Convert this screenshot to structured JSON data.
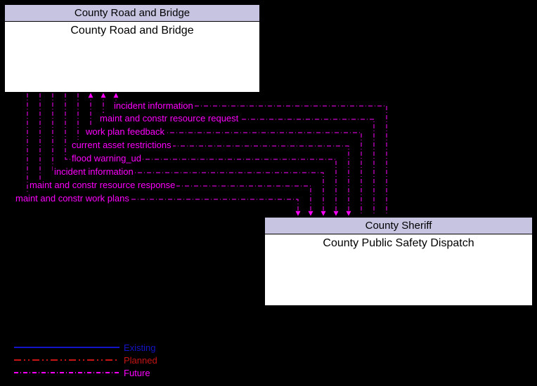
{
  "nodes": {
    "crb": {
      "header": "County Road and Bridge",
      "body": "County Road and Bridge"
    },
    "sheriff": {
      "header": "County Sheriff",
      "body": "County Public Safety Dispatch"
    }
  },
  "flows": [
    {
      "label": "incident information",
      "direction": "to_crb"
    },
    {
      "label": "maint and constr resource request",
      "direction": "to_crb"
    },
    {
      "label": "work plan feedback",
      "direction": "to_crb"
    },
    {
      "label": "current asset restrictions",
      "direction": "to_sheriff"
    },
    {
      "label": "flood warning_ud",
      "direction": "to_sheriff"
    },
    {
      "label": "incident information",
      "direction": "to_sheriff"
    },
    {
      "label": "maint and constr resource response",
      "direction": "to_sheriff"
    },
    {
      "label": "maint and constr work plans",
      "direction": "to_sheriff"
    }
  ],
  "legend": {
    "existing": "Existing",
    "planned": "Planned",
    "future": "Future"
  },
  "style": {
    "flow_color": "#ff00ff",
    "flow_pattern": "dashed-dot",
    "flow_status": "Future"
  },
  "chart_data": {
    "type": "node-link-diagram",
    "nodes": [
      {
        "id": "crb",
        "group": "County Road and Bridge",
        "label": "County Road and Bridge"
      },
      {
        "id": "sheriff",
        "group": "County Sheriff",
        "label": "County Public Safety Dispatch"
      }
    ],
    "edges": [
      {
        "from": "sheriff",
        "to": "crb",
        "label": "incident information",
        "status": "Future"
      },
      {
        "from": "sheriff",
        "to": "crb",
        "label": "maint and constr resource request",
        "status": "Future"
      },
      {
        "from": "sheriff",
        "to": "crb",
        "label": "work plan feedback",
        "status": "Future"
      },
      {
        "from": "crb",
        "to": "sheriff",
        "label": "current asset restrictions",
        "status": "Future"
      },
      {
        "from": "crb",
        "to": "sheriff",
        "label": "flood warning_ud",
        "status": "Future"
      },
      {
        "from": "crb",
        "to": "sheriff",
        "label": "incident information",
        "status": "Future"
      },
      {
        "from": "crb",
        "to": "sheriff",
        "label": "maint and constr resource response",
        "status": "Future"
      },
      {
        "from": "crb",
        "to": "sheriff",
        "label": "maint and constr work plans",
        "status": "Future"
      }
    ]
  }
}
